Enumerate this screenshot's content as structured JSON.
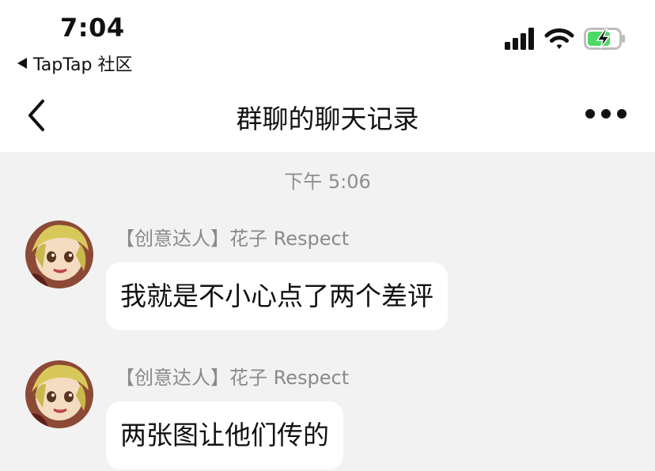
{
  "status_bar": {
    "time": "7:04",
    "back_app_label": "TapTap 社区",
    "icons": [
      "signal-icon",
      "wifi-icon",
      "battery-charging-icon"
    ]
  },
  "nav": {
    "title": "群聊的聊天记录",
    "back_icon": "chevron-left-icon",
    "more_icon": "more-icon"
  },
  "chat": {
    "timestamp": "下午 5:06",
    "messages": [
      {
        "sender": "【创意达人】花子 Respect",
        "text": "我就是不小心点了两个差评"
      },
      {
        "sender": "【创意达人】花子 Respect",
        "text": "两张图让他们传的"
      }
    ]
  },
  "colors": {
    "nav_background": "#ffffff",
    "chat_background": "#f2f2f2",
    "bubble": "#ffffff",
    "battery_fill": "#4cd964",
    "secondary_text": "#8a8a8a"
  }
}
